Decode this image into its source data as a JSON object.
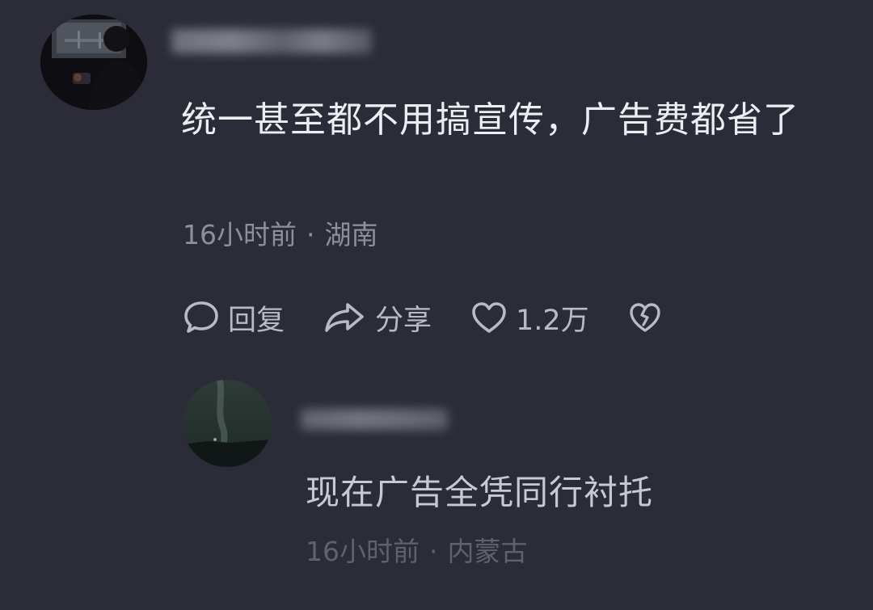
{
  "comment": {
    "text": "统一甚至都不用搞宣传，广告费都省了",
    "time": "16小时前",
    "separator": "·",
    "location": "湖南"
  },
  "actions": {
    "reply_label": "回复",
    "share_label": "分享",
    "like_count": "1.2万",
    "icons": [
      "reply-bubble-icon",
      "share-arrow-icon",
      "heart-icon",
      "broken-heart-icon"
    ]
  },
  "reply": {
    "text": "现在广告全凭同行衬托",
    "time": "16小时前",
    "separator": "·",
    "location": "内蒙古"
  },
  "colors": {
    "background": "#2b2c37",
    "primary_text": "#eceef2",
    "meta_text": "#8d8f99",
    "action_text": "#b9bbc4"
  }
}
